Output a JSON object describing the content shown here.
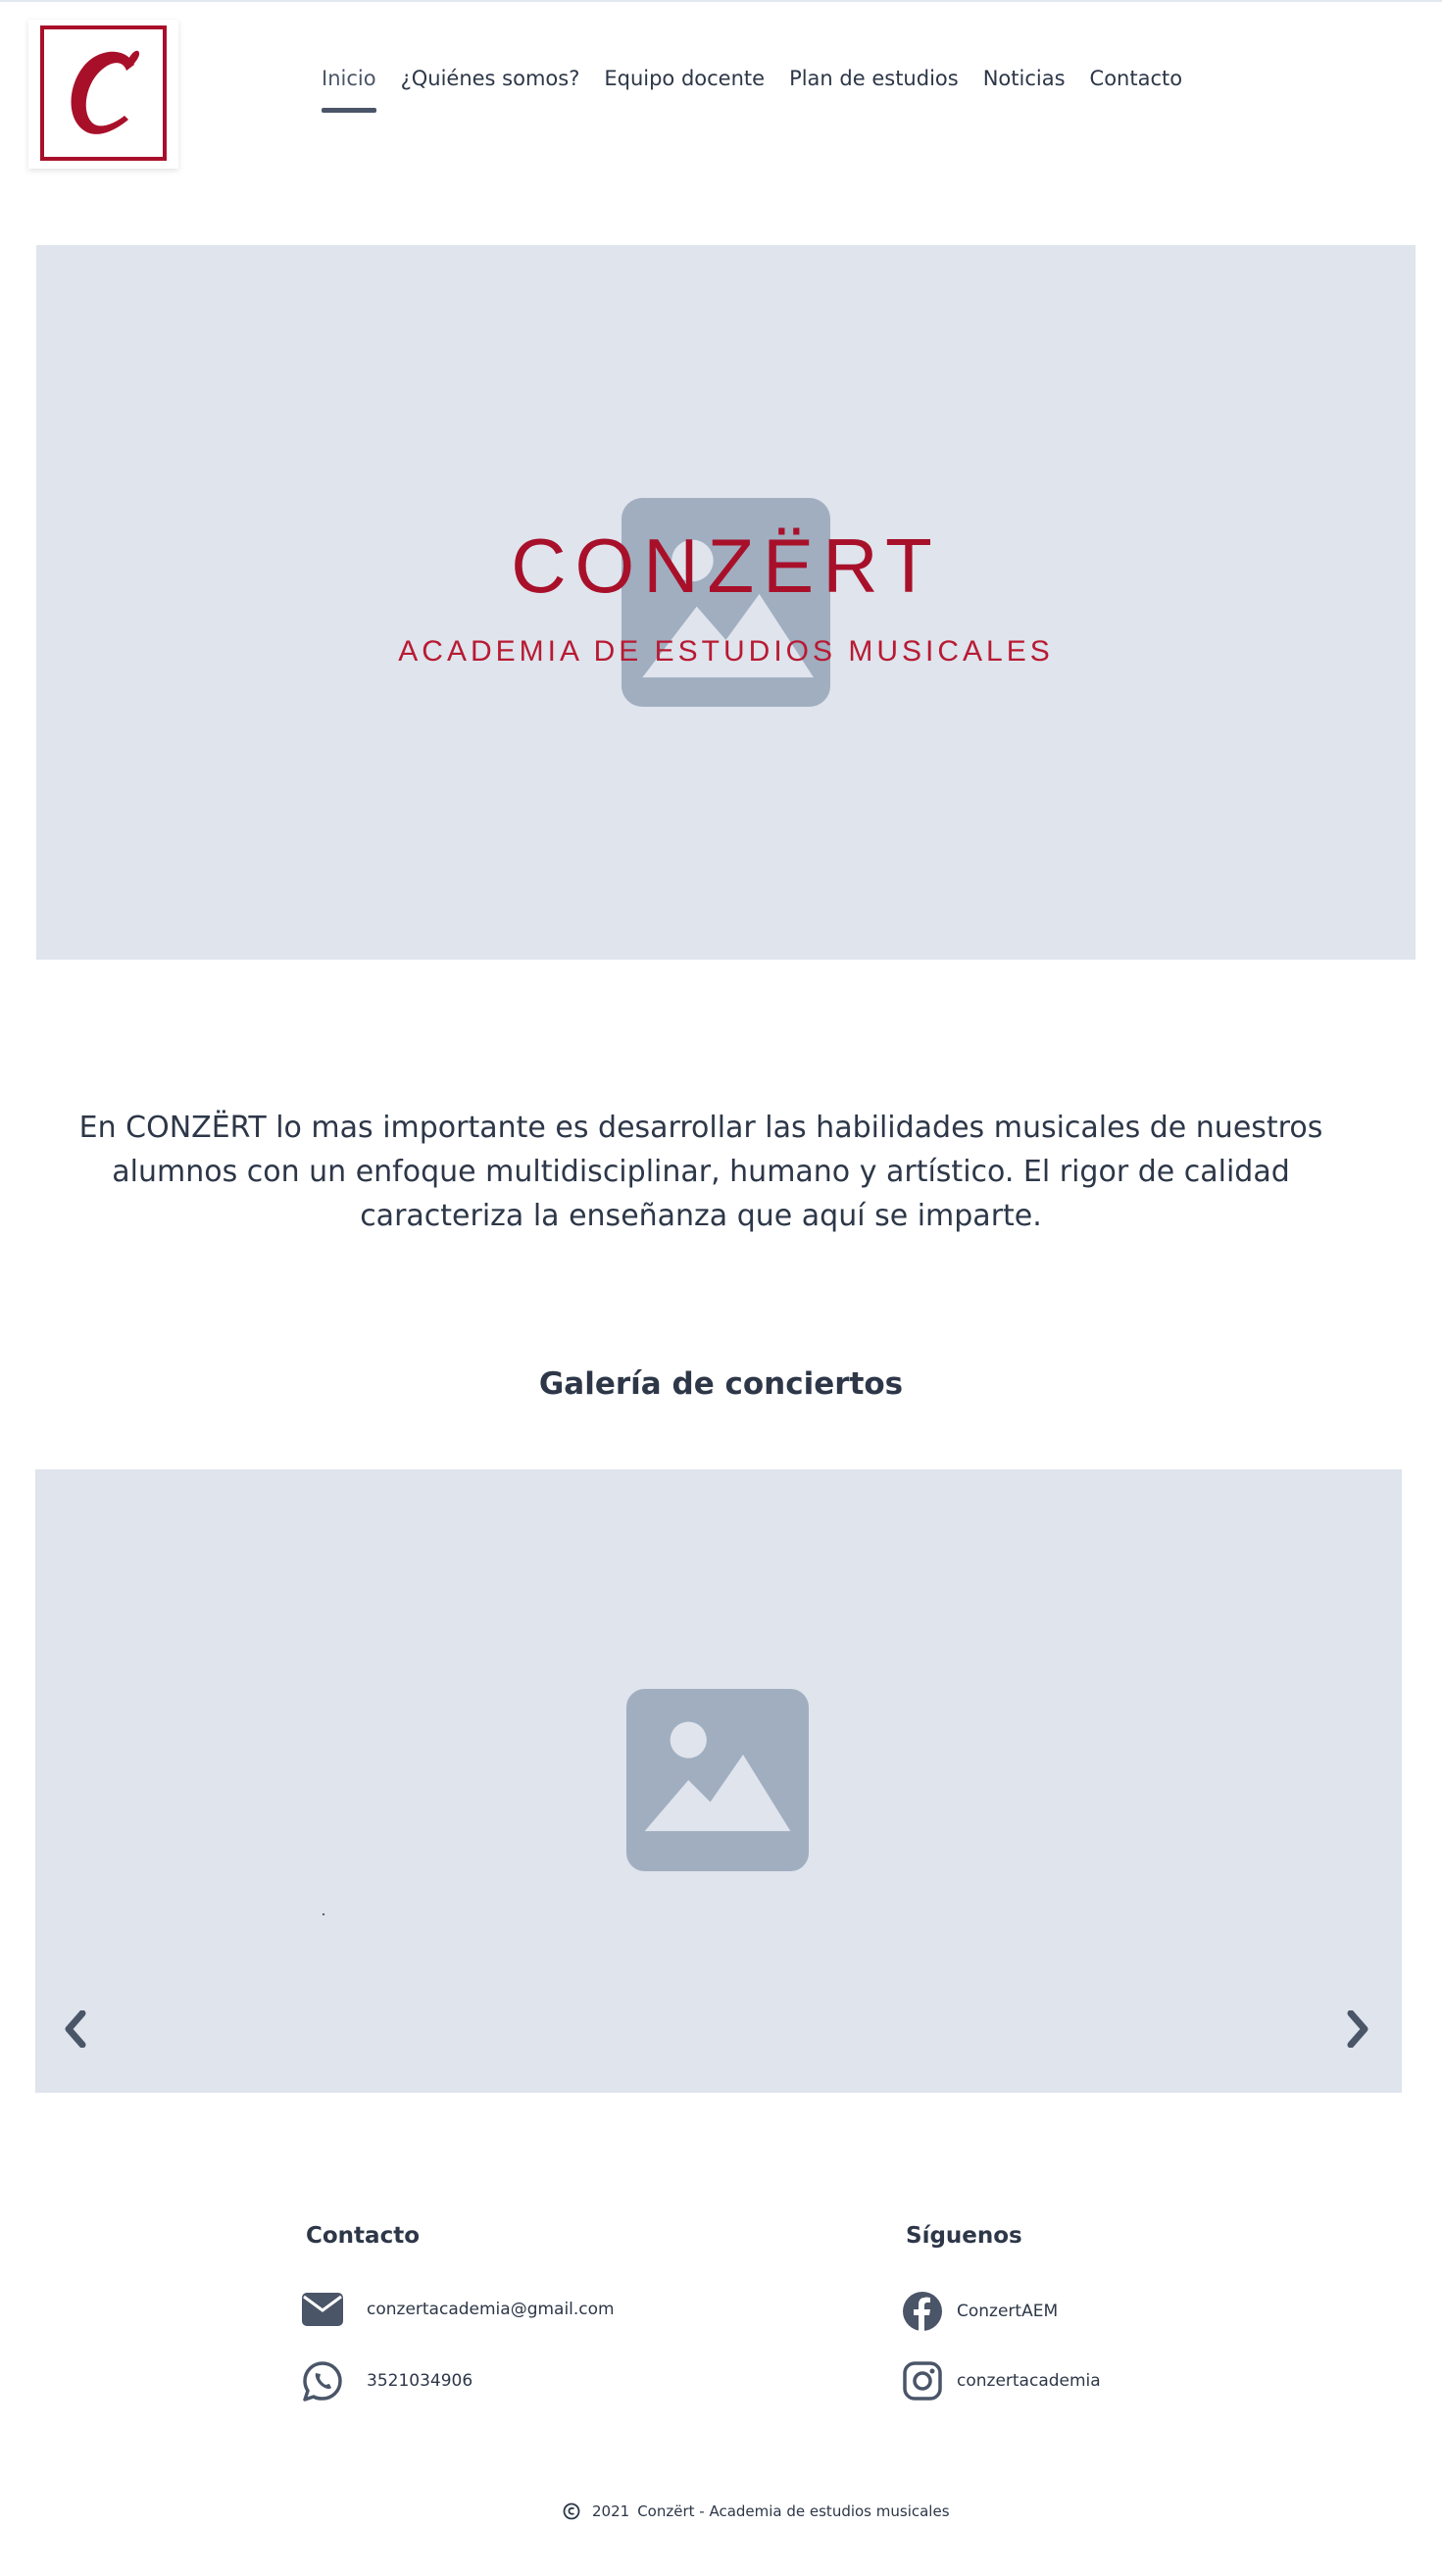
{
  "header": {
    "nav": [
      {
        "label": "Inicio",
        "active": true
      },
      {
        "label": "¿Quiénes somos?",
        "active": false
      },
      {
        "label": "Equipo docente",
        "active": false
      },
      {
        "label": "Plan de estudios",
        "active": false
      },
      {
        "label": "Noticias",
        "active": false
      },
      {
        "label": "Contacto",
        "active": false
      }
    ],
    "logo_letter": "C"
  },
  "hero": {
    "title": "CONZËRT",
    "subtitle": "ACADEMIA DE ESTUDIOS MUSICALES",
    "image_icon": "image-placeholder-icon"
  },
  "intro": {
    "text": "En CONZËRT lo mas importante es desarrollar las habilidades musicales de nuestros alumnos con un enfoque multidisciplinar, humano y artístico. El rigor de calidad caracteriza la enseñanza que aquí se imparte."
  },
  "gallery": {
    "title": "Galería de conciertos",
    "prev_icon": "chevron-left-icon",
    "next_icon": "chevron-right-icon"
  },
  "footer": {
    "contact": {
      "heading": "Contacto",
      "email": "conzertacademia@gmail.com",
      "phone": "3521034906"
    },
    "social": {
      "heading": "Síguenos",
      "facebook": "ConzertAEM",
      "instagram": "conzertacademia"
    },
    "copyright": {
      "year": "2021",
      "text": "Conzërt - Academia de estudios musicales"
    }
  },
  "colors": {
    "brand_red": "#a8102a",
    "placeholder_bg": "#dfe4ed",
    "icon_gray": "#a0aec0",
    "text_dark": "#2d3748",
    "nav_active": "#4a5568"
  }
}
